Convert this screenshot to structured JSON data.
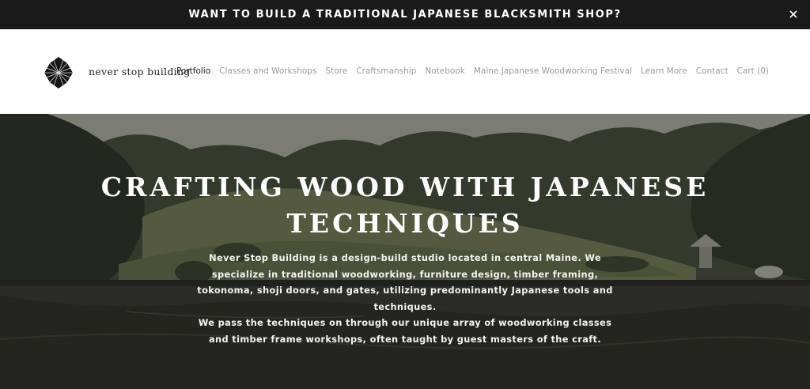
{
  "announcement": {
    "text": "WANT TO BUILD A TRADITIONAL JAPANESE BLACKSMITH SHOP?",
    "close_icon": "close-icon"
  },
  "header": {
    "logo_icon": "pinecone-logo-icon",
    "brand_name": "never stop building",
    "nav": [
      {
        "label": "Portfolio",
        "active": true
      },
      {
        "label": "Classes and Workshops",
        "active": false
      },
      {
        "label": "Store",
        "active": false
      },
      {
        "label": "Craftsmanship",
        "active": false
      },
      {
        "label": "Notebook",
        "active": false
      },
      {
        "label": "Maine Japanese Woodworking Festival",
        "active": false
      },
      {
        "label": "Learn More",
        "active": false
      },
      {
        "label": "Contact",
        "active": false
      },
      {
        "label": "Cart (0)",
        "active": false
      }
    ]
  },
  "hero": {
    "title_line1": "CRAFTING WOOD WITH JAPANESE",
    "title_line2": "TECHNIQUES",
    "paragraph1": "Never Stop Building is a design-build studio located in central Maine. We specialize in traditional woodworking, furniture design, timber framing, tokonoma, shoji doors, and gates, utilizing predominantly Japanese tools and techniques.",
    "paragraph2": "We pass the techniques on through our unique array of woodworking classes and timber frame workshops, often taught by guest masters of the craft."
  },
  "colors": {
    "announcement_bg": "#1a1a1a",
    "nav_active": "#1a1a1a",
    "nav_inactive": "#9a9a9a"
  }
}
